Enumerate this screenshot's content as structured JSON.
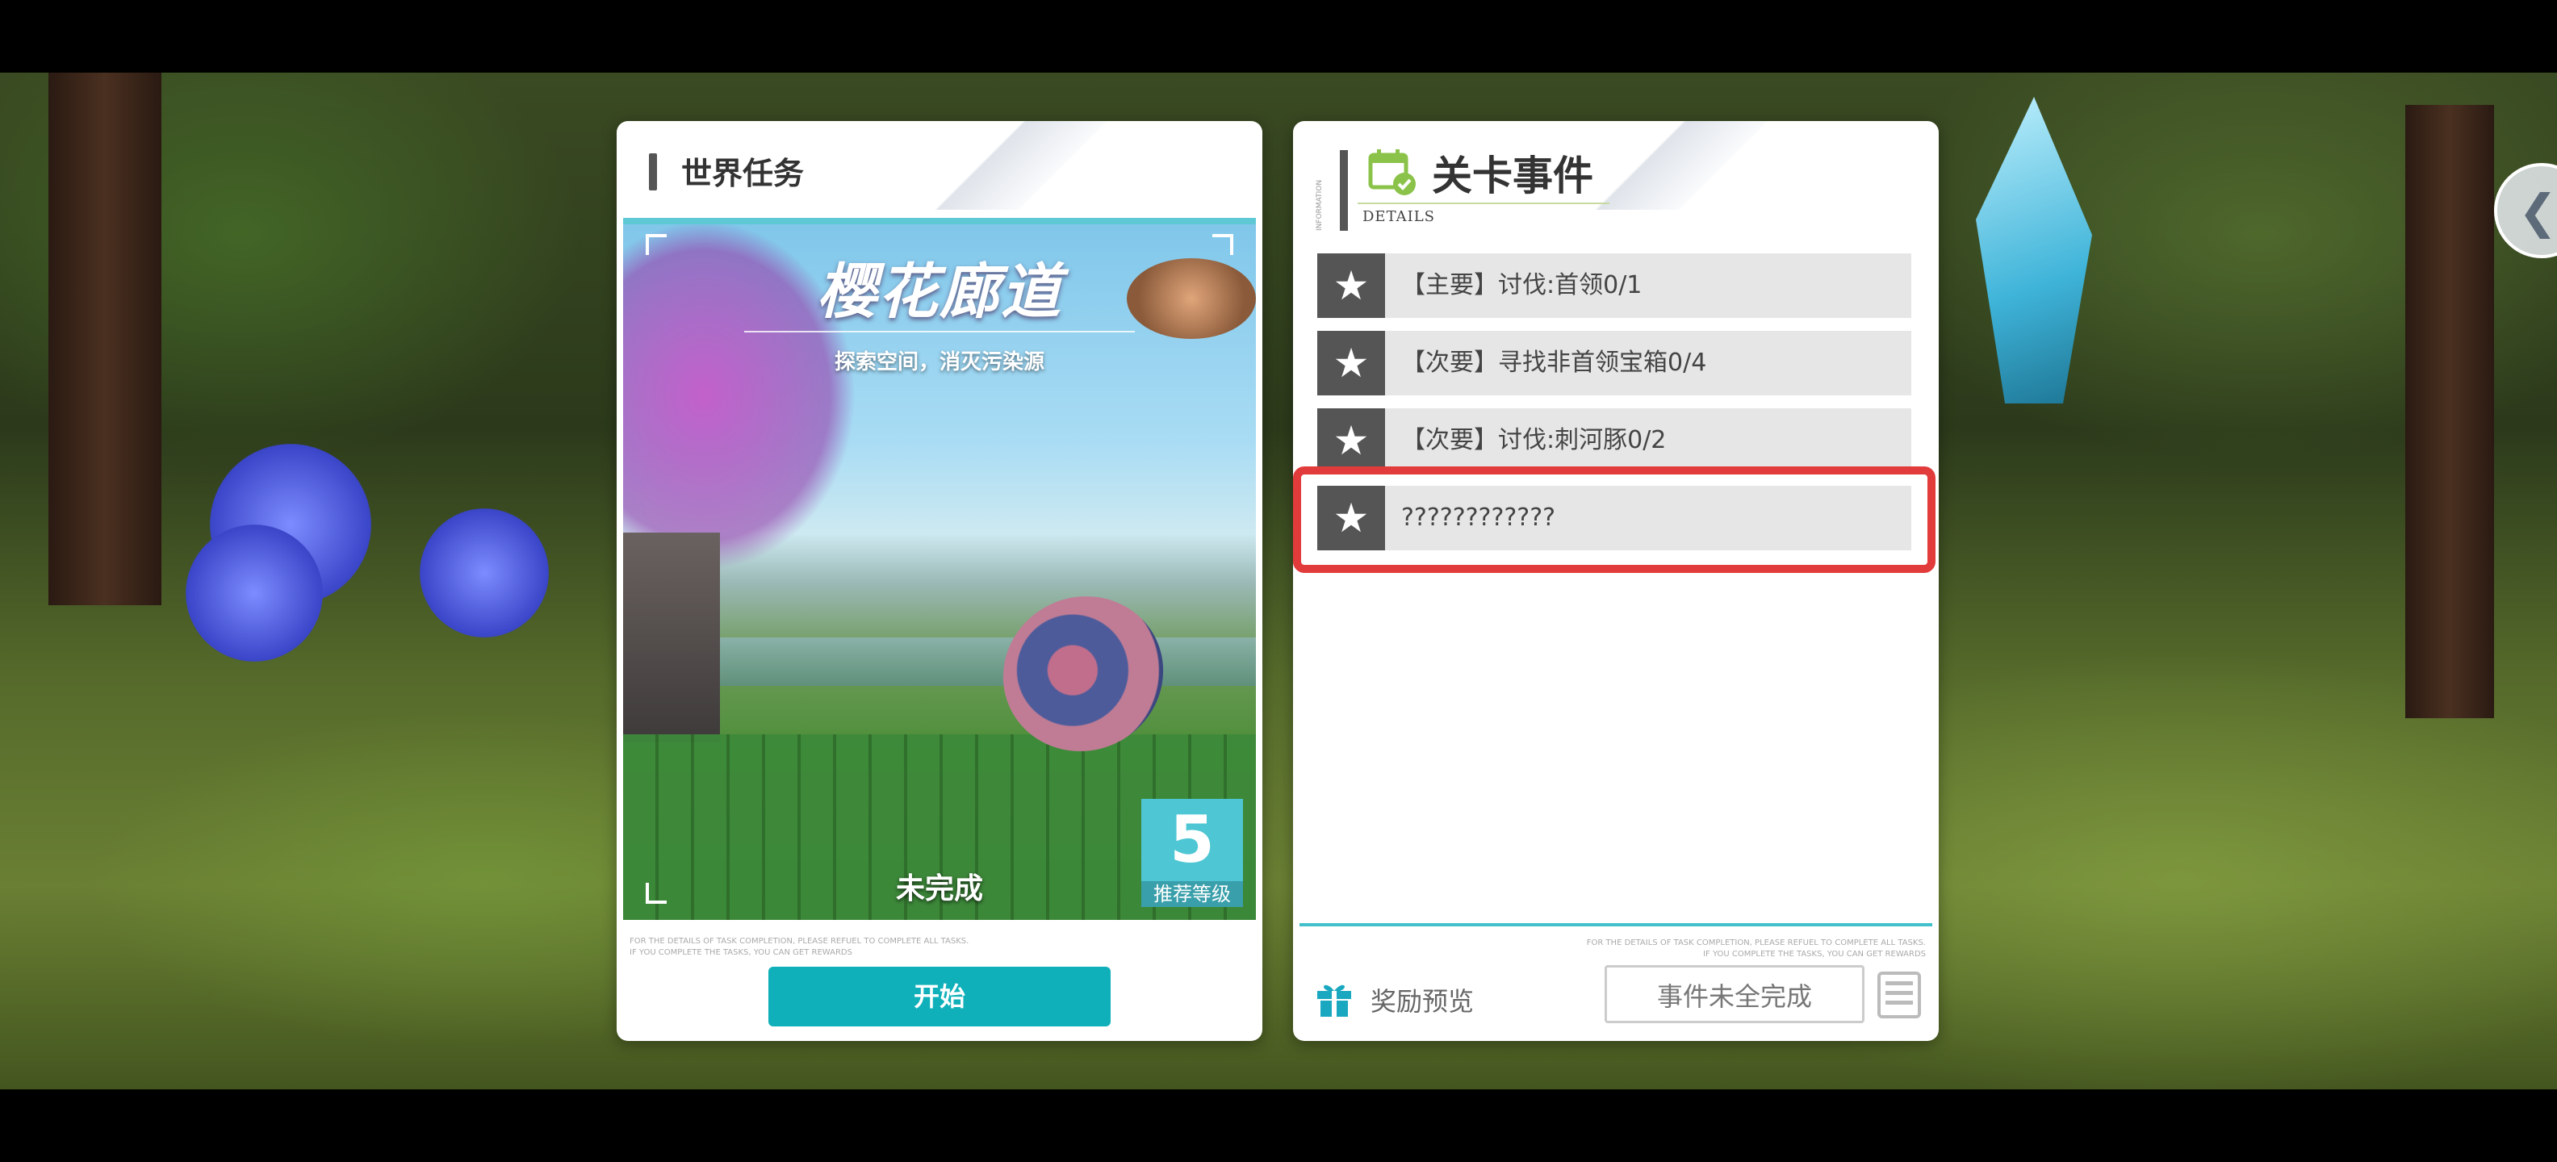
{
  "left_panel": {
    "title": "世界任务",
    "stage": {
      "name": "樱花廊道",
      "subtitle": "探索空间，消灭污染源",
      "status": "未完成",
      "level": "5",
      "level_label": "推荐等级"
    },
    "fine_print_1": "FOR THE DETAILS OF TASK COMPLETION, PLEASE REFUEL TO COMPLETE ALL TASKS.",
    "fine_print_2": "IF YOU COMPLETE THE TASKS, YOU CAN GET REWARDS",
    "start_button": "开始"
  },
  "right_panel": {
    "vertical_tag": "INFORMATION",
    "title": "关卡事件",
    "subtitle": "DETAILS",
    "events": [
      {
        "text": "【主要】讨伐:首领0/1"
      },
      {
        "text": "【次要】寻找非首领宝箱0/4"
      },
      {
        "text": "【次要】讨伐:刺河豚0/2"
      },
      {
        "text": "????????????"
      }
    ],
    "fine_print_1": "FOR THE DETAILS OF TASK COMPLETION, PLEASE REFUEL TO COMPLETE ALL TASKS.",
    "fine_print_2": "IF YOU COMPLETE THE TASKS, YOU CAN GET REWARDS",
    "reward_preview": "奖励预览",
    "incomplete_button": "事件未全完成"
  },
  "icons": {
    "star": "★",
    "back": "❮"
  },
  "colors": {
    "accent_teal": "#0fb0ba",
    "highlight_red": "#e23b3b",
    "level_badge": "#4fc6d3",
    "header_gray": "#555555"
  }
}
